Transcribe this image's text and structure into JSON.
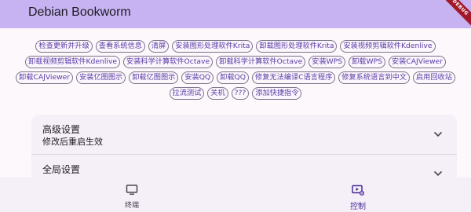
{
  "appbar": {
    "title": "Debian Bookworm",
    "debug_badge": "DEBUG"
  },
  "chips": [
    "检查更新并升级",
    "查看系统信息",
    "清屏",
    "安装图形处理软件Krita",
    "卸载图形处理软件Krita",
    "安装视频剪辑软件Kdenlive",
    "卸载视频剪辑软件Kdenlive",
    "安装科学计算软件Octave",
    "卸载科学计算软件Octave",
    "安装WPS",
    "卸载WPS",
    "安装CAJViewer",
    "卸载CAJViewer",
    "安装亿图图示",
    "卸载亿图图示",
    "安装QQ",
    "卸载QQ",
    "修复无法编译C语言程序",
    "修复系统语言到中文",
    "启用回收站",
    "拉流测试",
    "关机",
    "???",
    "添加快捷指令"
  ],
  "settings": {
    "advanced": {
      "title": "高级设置",
      "subtitle": "修改后重启生效"
    },
    "global": {
      "title": "全局设置"
    }
  },
  "nav": {
    "terminal": {
      "label": "终端",
      "icon": "monitor-icon"
    },
    "control": {
      "label": "控制",
      "icon": "control-icon"
    }
  },
  "colors": {
    "appbar": "#c7b3f2",
    "accent": "#5a3aa6",
    "debug": "#a4192a"
  }
}
